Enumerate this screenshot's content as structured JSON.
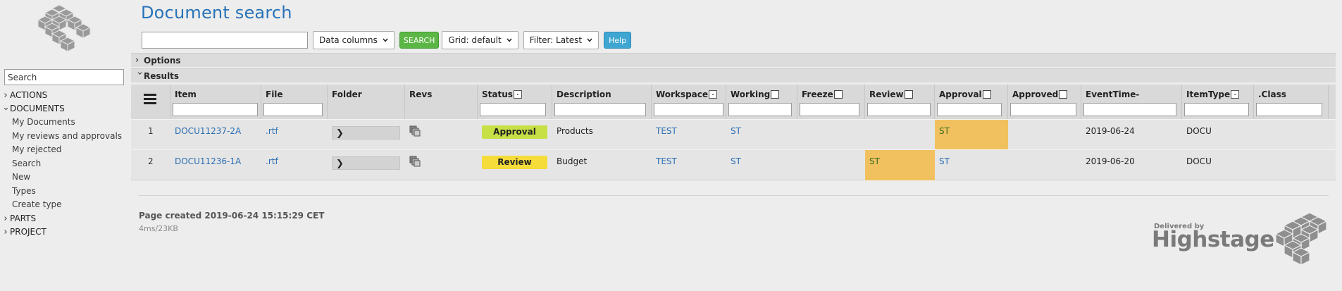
{
  "app": {
    "title": "Document search"
  },
  "sidebar": {
    "search_placeholder": "Search",
    "nav": [
      {
        "label": "ACTIONS",
        "expanded": false
      },
      {
        "label": "DOCUMENTS",
        "expanded": true,
        "items": [
          "My Documents",
          "My reviews and approvals",
          "My rejected",
          "Search",
          "New",
          "Types",
          "Create type"
        ]
      },
      {
        "label": "PARTS",
        "expanded": false
      },
      {
        "label": "PROJECT",
        "expanded": false
      }
    ]
  },
  "toolbar": {
    "search_value": "",
    "columns_select": "Data columns",
    "search_button": "SEARCH",
    "grid_select": "Grid: default",
    "filter_select": "Filter: Latest",
    "help_button": "Help"
  },
  "sections": {
    "options": "Options",
    "results": "Results"
  },
  "table": {
    "columns": [
      "Item",
      "File",
      "Folder",
      "Revs",
      "Status",
      "Description",
      "Workspace",
      "Working",
      "Freeze",
      "Review",
      "Approval",
      "Approved",
      "EventTime-",
      "ItemType",
      ".Class"
    ],
    "rows": [
      {
        "num": "1",
        "item": "DOCU11237-2A",
        "file": ".rtf",
        "status": "Approval",
        "status_color": "#c6e046",
        "description": "Products",
        "workspace": "TEST",
        "working": "ST",
        "freeze": "",
        "review": "",
        "approval": "ST",
        "approved": "",
        "eventtime": "2019-06-24",
        "itemtype": "DOCU",
        "class": ""
      },
      {
        "num": "2",
        "item": "DOCU11236-1A",
        "file": ".rtf",
        "status": "Review",
        "status_color": "#f5dc3a",
        "description": "Budget",
        "workspace": "TEST",
        "working": "ST",
        "freeze": "",
        "review": "ST",
        "approval": "ST",
        "approved": "",
        "eventtime": "2019-06-20",
        "itemtype": "DOCU",
        "class": ""
      }
    ],
    "highlight_color": "#f1c160"
  },
  "footer": {
    "page_created": "Page created 2019-06-24 15:15:29 CET",
    "stats": "4ms/23KB",
    "brand_small": "Delivered by",
    "brand_name": "Highstage"
  },
  "icons": {
    "logo": "cube-logo-icon",
    "menu": "hamburger-menu-icon",
    "revs": "revisions-stack-icon",
    "folder": "chevron-right-icon"
  }
}
